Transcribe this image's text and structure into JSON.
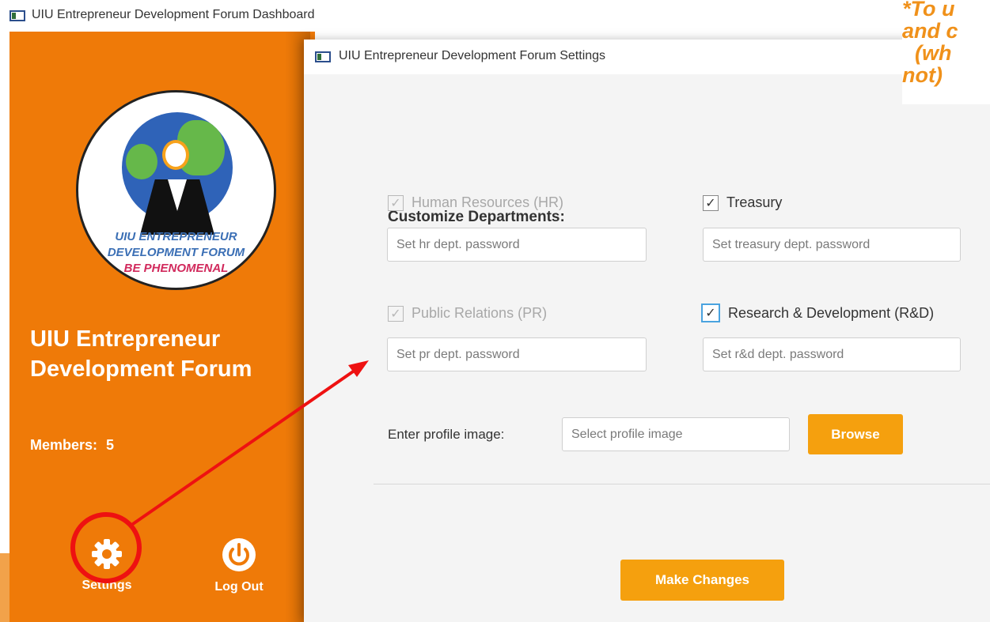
{
  "dashboard": {
    "window_title": "UIU Entrepreneur Development Forum Dashboard",
    "logo": {
      "line1": "UIU ENTREPRENEUR",
      "line2": "DEVELOPMENT FORUM",
      "line3": "BE PHENOMENAL"
    },
    "forum_name": "UIU Entrepreneur Development Forum",
    "members_label": "Members:",
    "members_count": "5",
    "nav": {
      "settings_label": "Settings",
      "logout_label": "Log Out"
    },
    "accent_color": "#ef7a08"
  },
  "settings": {
    "window_title": "UIU Entrepreneur Development Forum Settings",
    "section_title": "Customize Departments:",
    "departments": [
      {
        "label": "Human Resources (HR)",
        "checked": true,
        "disabled": true,
        "password_placeholder": "Set hr dept. password"
      },
      {
        "label": "Treasury",
        "checked": true,
        "disabled": false,
        "password_placeholder": "Set treasury dept. password"
      },
      {
        "label": "Public Relations (PR)",
        "checked": true,
        "disabled": true,
        "password_placeholder": "Set pr dept. password"
      },
      {
        "label": "Research & Development (R&D)",
        "checked": true,
        "disabled": false,
        "password_placeholder": "Set r&d dept. password"
      }
    ],
    "profile_image_label": "Enter profile image:",
    "profile_image_placeholder": "Select profile image",
    "browse_label": "Browse",
    "submit_label": "Make Changes",
    "button_color": "#f5a00e"
  },
  "note": {
    "lines": [
      "*To u",
      "and c",
      "(wh",
      "not)"
    ]
  },
  "icons": {
    "settings": "gear-icon",
    "logout": "power-icon",
    "window": "window-icon",
    "check": "checkmark-icon"
  }
}
